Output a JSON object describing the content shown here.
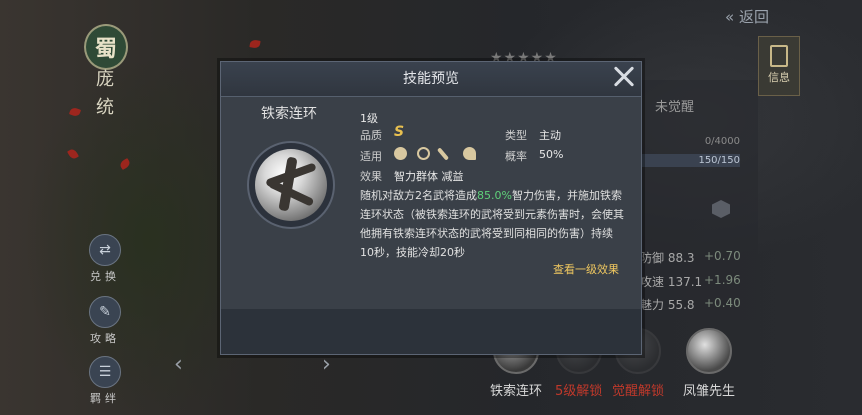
{
  "background": {
    "kingdom_badge": "蜀",
    "general_name": "庞统",
    "back_label": "返回",
    "info_tab_label": "信息",
    "unawakened_label": "未觉醒",
    "progress_1": "0/4000",
    "progress_2": "150/150",
    "stats": [
      {
        "label": "防御 88.3",
        "bonus": "+0.70"
      },
      {
        "label": "攻速 137.1",
        "bonus": "+1.96"
      },
      {
        "label": "魅力 55.8",
        "bonus": "+0.40"
      }
    ],
    "side_buttons": [
      {
        "label": "兑换",
        "icon": "exchange-icon"
      },
      {
        "label": "攻略",
        "icon": "guide-icon"
      },
      {
        "label": "羁绊",
        "icon": "bond-icon"
      }
    ],
    "bottom_skills": [
      {
        "label": "铁索连环",
        "color": "#d8d8d8"
      },
      {
        "label": "5级解锁",
        "color": "#c0392b"
      },
      {
        "label": "觉醒解锁",
        "color": "#c0392b"
      },
      {
        "label": "凤雏先生",
        "color": "#d8d8d8"
      }
    ]
  },
  "modal": {
    "title": "技能预览",
    "skill_name": "铁索连环",
    "level": "1级",
    "quality_label": "品质",
    "quality_value": "S",
    "type_label": "类型",
    "type_value": "主动",
    "apply_label": "适用",
    "apply_icons": [
      "shield-unit-icon",
      "bow-unit-icon",
      "spear-unit-icon",
      "cavalry-unit-icon"
    ],
    "chance_label": "概率",
    "chance_value": "50%",
    "effect_label": "效果",
    "effect_value": "智力群体 减益",
    "desc_1": "随机对敌方2名武将造成",
    "desc_highlight": "85.0%",
    "desc_2": "智力伤害，并施加铁索连环状态（被铁索连环的武将受到元素伤害时，会使其他拥有铁索连环状态的武将受到同相同的伤害）持续10秒，技能冷却20秒",
    "more_link": "查看一级效果"
  },
  "colors": {
    "highlight_green": "#5fd07a",
    "quality_gold": "#e8c050",
    "link_gold": "#f0c860",
    "locked_red": "#c0392b"
  }
}
